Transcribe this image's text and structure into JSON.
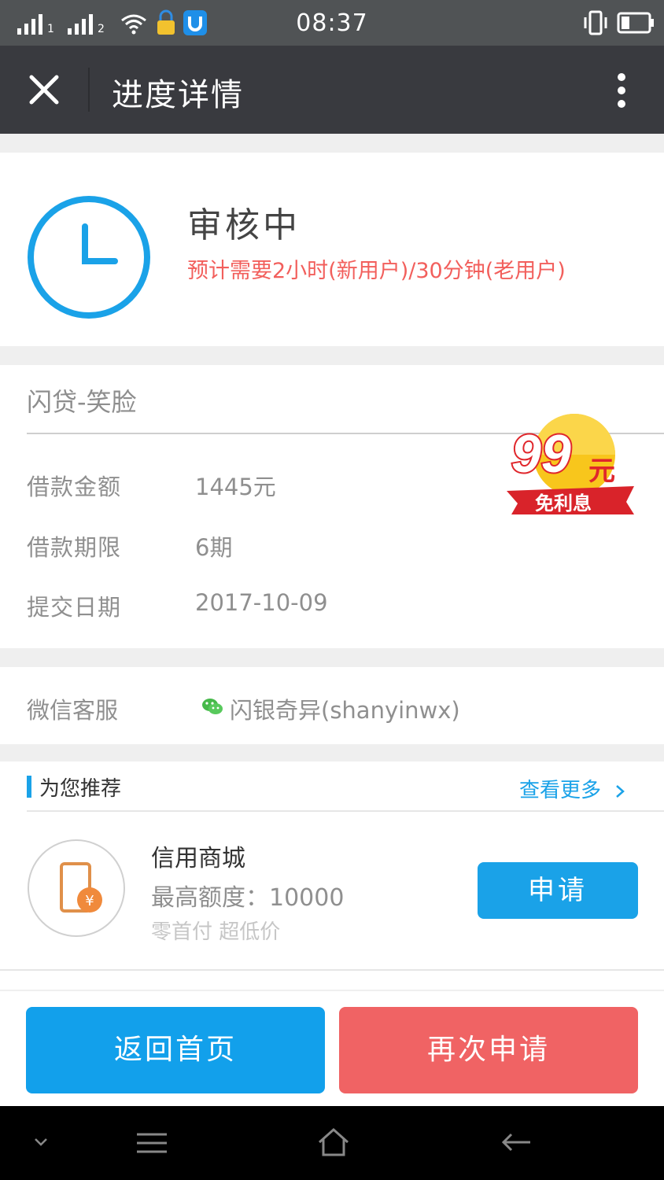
{
  "status_bar": {
    "time": "08:37",
    "sim1": "1",
    "sim2": "2"
  },
  "nav": {
    "title": "进度详情"
  },
  "status": {
    "title": "审核中",
    "subtitle": "预计需要2小时(新用户)/30分钟(老用户)"
  },
  "loan": {
    "name": "闪贷-笑脸",
    "rows": [
      {
        "label": "借款金额",
        "value": "1445元"
      },
      {
        "label": "借款期限",
        "value": "6期"
      },
      {
        "label": "提交日期",
        "value": "2017-10-09"
      }
    ],
    "badge": {
      "number": "99",
      "unit": "元",
      "text": "免利息"
    }
  },
  "wechat": {
    "label": "微信客服",
    "value": "闪银奇异(shanyinwx)"
  },
  "recommend": {
    "title": "为您推荐",
    "more": "查看更多",
    "product": {
      "name": "信用商城",
      "limit": "最高额度：10000",
      "tag": "零首付 超低价",
      "apply": "申请"
    }
  },
  "footer": {
    "home": "返回首页",
    "again": "再次申请"
  },
  "icons": {
    "close": "close-icon",
    "more": "more-vertical-icon",
    "clock": "clock-icon",
    "wechat": "wechat-icon",
    "phone": "phone-icon",
    "chevron": "chevron-right-icon"
  },
  "colors": {
    "accent": "#1aa2e8",
    "danger": "#f06364",
    "subtitle": "#f25f5c",
    "navbar": "#393a3f"
  }
}
